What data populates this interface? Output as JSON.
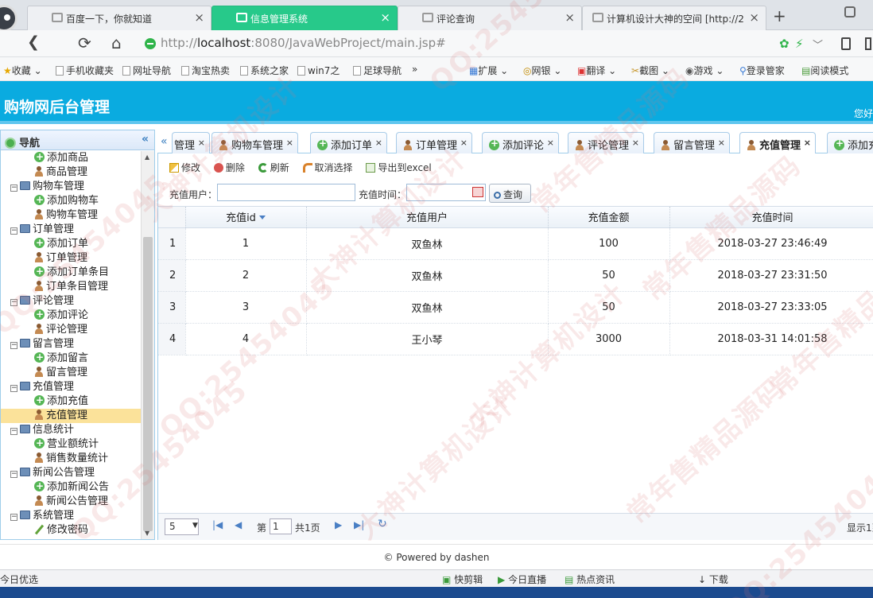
{
  "browser": {
    "tabs": [
      {
        "label": "百度一下，你就知道",
        "active": false
      },
      {
        "label": "信息管理系统",
        "active": true
      },
      {
        "label": "评论查询",
        "active": false
      },
      {
        "label": "计算机设计大神的空间 [http://2",
        "active": false
      }
    ],
    "url_host": "localhost",
    "url_rest": ":8080/JavaWebProject/main.jsp#",
    "url_prefix": "http://"
  },
  "bookmarks": {
    "left": [
      "收藏",
      "手机收藏夹",
      "网址导航",
      "淘宝热卖",
      "系统之家",
      "win7之",
      "足球导航"
    ],
    "more": "»",
    "right": [
      "扩展",
      "网银",
      "翻译",
      "截图",
      "游戏",
      "登录管家",
      "阅读模式"
    ]
  },
  "app": {
    "title": "购物网后台管理",
    "greeting": "您好"
  },
  "nav": {
    "title": "导航",
    "collapse": "«",
    "items": [
      {
        "label": "添加商品",
        "type": "add"
      },
      {
        "label": "商品管理",
        "type": "manage"
      },
      {
        "label": "购物车管理",
        "type": "folder"
      },
      {
        "label": "添加购物车",
        "type": "add"
      },
      {
        "label": "购物车管理",
        "type": "manage"
      },
      {
        "label": "订单管理",
        "type": "folder"
      },
      {
        "label": "添加订单",
        "type": "add"
      },
      {
        "label": "订单管理",
        "type": "manage"
      },
      {
        "label": "添加订单条目",
        "type": "add"
      },
      {
        "label": "订单条目管理",
        "type": "manage"
      },
      {
        "label": "评论管理",
        "type": "folder"
      },
      {
        "label": "添加评论",
        "type": "add"
      },
      {
        "label": "评论管理",
        "type": "manage"
      },
      {
        "label": "留言管理",
        "type": "folder"
      },
      {
        "label": "添加留言",
        "type": "add"
      },
      {
        "label": "留言管理",
        "type": "manage"
      },
      {
        "label": "充值管理",
        "type": "folder"
      },
      {
        "label": "添加充值",
        "type": "add"
      },
      {
        "label": "充值管理",
        "type": "manage",
        "selected": true
      },
      {
        "label": "信息统计",
        "type": "folder"
      },
      {
        "label": "营业额统计",
        "type": "add"
      },
      {
        "label": "销售数量统计",
        "type": "manage"
      },
      {
        "label": "新闻公告管理",
        "type": "folder"
      },
      {
        "label": "添加新闻公告",
        "type": "add"
      },
      {
        "label": "新闻公告管理",
        "type": "manage"
      },
      {
        "label": "系统管理",
        "type": "folder"
      },
      {
        "label": "修改密码",
        "type": "pen"
      }
    ]
  },
  "content_tabs": [
    {
      "label": "管理",
      "icon": "none"
    },
    {
      "label": "购物车管理",
      "icon": "user"
    },
    {
      "label": "添加订单",
      "icon": "add"
    },
    {
      "label": "订单管理",
      "icon": "user"
    },
    {
      "label": "添加评论",
      "icon": "add"
    },
    {
      "label": "评论管理",
      "icon": "user"
    },
    {
      "label": "留言管理",
      "icon": "user"
    },
    {
      "label": "充值管理",
      "icon": "user",
      "active": true
    },
    {
      "label": "添加充",
      "icon": "add"
    }
  ],
  "toolbar": {
    "edit": "修改",
    "delete": "删除",
    "refresh": "刷新",
    "cancel_select": "取消选择",
    "export": "导出到excel"
  },
  "search": {
    "user_label": "充值用户：",
    "time_label": "充值时间：",
    "button": "查询"
  },
  "table": {
    "columns": [
      "充值id",
      "充值用户",
      "充值金额",
      "充值时间"
    ],
    "rows": [
      {
        "n": "1",
        "id": "1",
        "user": "双鱼林",
        "amount": "100",
        "time": "2018-03-27 23:46:49"
      },
      {
        "n": "2",
        "id": "2",
        "user": "双鱼林",
        "amount": "50",
        "time": "2018-03-27 23:31:50"
      },
      {
        "n": "3",
        "id": "3",
        "user": "双鱼林",
        "amount": "50",
        "time": "2018-03-27 23:33:05"
      },
      {
        "n": "4",
        "id": "4",
        "user": "王小琴",
        "amount": "3000",
        "time": "2018-03-31 14:01:58"
      }
    ]
  },
  "pager": {
    "page_size": "5",
    "page_prefix": "第",
    "page_value": "1",
    "page_total": "共1页",
    "display": "显示1到"
  },
  "footer": "© Powered by dashen",
  "statusbar": {
    "left": "今日优选",
    "items": [
      "快剪辑",
      "今日直播",
      "热点资讯",
      "下载"
    ]
  },
  "watermark": [
    "QQ:25454",
    "大神计算机设计",
    "常年售精品源码",
    "QQ:25454045",
    "大神计算机设计",
    "常年售精品源码",
    "QQ:25454045",
    "大神计算机设计",
    "常年售精品源码",
    "QQ:25454045",
    "大神计算机设计",
    "常年售精品源码",
    "QQ:25454045"
  ],
  "colors": {
    "header": "#0aabe0",
    "active_tab": "#27c98a",
    "selected_nav": "#fbe29a"
  }
}
